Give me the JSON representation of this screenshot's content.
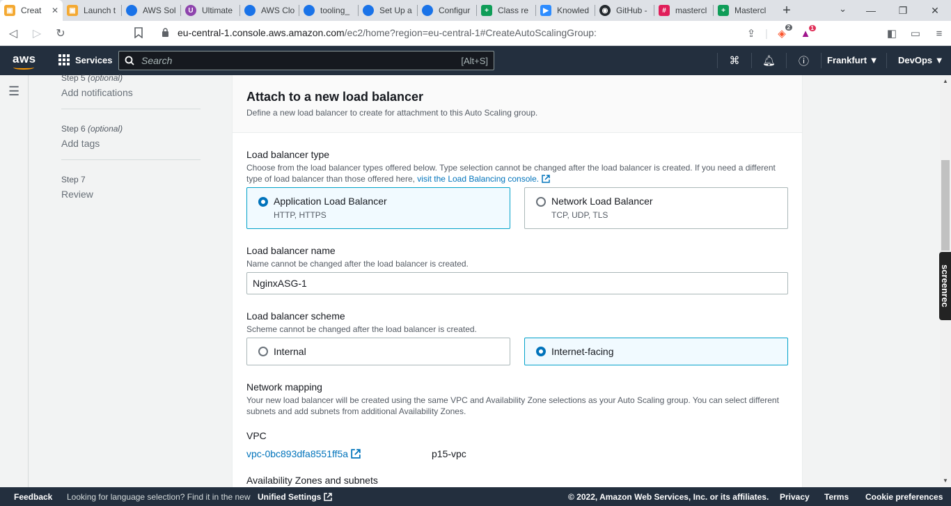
{
  "browser": {
    "tabs": [
      {
        "title": "Creat",
        "icon": "aws-box-icon",
        "color": "#f4a932"
      },
      {
        "title": "Launch t",
        "icon": "aws-box-icon",
        "color": "#f4a932"
      },
      {
        "title": "AWS Sol",
        "icon": "blue-drop-icon",
        "color": "#1a73e8"
      },
      {
        "title": "Ultimate",
        "icon": "purple-circle-icon",
        "color": "#8e44ad"
      },
      {
        "title": "AWS Clo",
        "icon": "blue-drop-icon",
        "color": "#1a73e8"
      },
      {
        "title": "tooling_",
        "icon": "blue-drop-icon",
        "color": "#1a73e8"
      },
      {
        "title": "Set Up a",
        "icon": "blue-drop-icon",
        "color": "#1a73e8"
      },
      {
        "title": "Configur",
        "icon": "blue-drop-icon",
        "color": "#1a73e8"
      },
      {
        "title": "Class re",
        "icon": "green-plus-icon",
        "color": "#0f9d58"
      },
      {
        "title": "Knowled",
        "icon": "zoom-icon",
        "color": "#2d8cff"
      },
      {
        "title": "GitHub -",
        "icon": "github-icon",
        "color": "#24292e"
      },
      {
        "title": "mastercl",
        "icon": "slack-icon",
        "color": "#e01e5a"
      },
      {
        "title": "Mastercl",
        "icon": "green-plus-icon",
        "color": "#0f9d58"
      }
    ],
    "url_host": "eu-central-1.console.aws.amazon.com",
    "url_path": "/ec2/home?region=eu-central-1#CreateAutoScalingGroup:",
    "brave_badge": "2",
    "alert_badge": "1"
  },
  "aws": {
    "logo": "aws",
    "services_label": "Services",
    "search_placeholder": "Search",
    "search_shortcut": "[Alt+S]",
    "region": "Frankfurt ▼",
    "account": "DevOps ▼"
  },
  "steps": [
    {
      "num": "Step 5",
      "optional": "(optional)",
      "label": "Add notifications"
    },
    {
      "num": "Step 6",
      "optional": "(optional)",
      "label": "Add tags"
    },
    {
      "num": "Step 7",
      "optional": "",
      "label": "Review"
    }
  ],
  "main": {
    "title": "Attach to a new load balancer",
    "description": "Define a new load balancer to create for attachment to this Auto Scaling group.",
    "lb_type": {
      "label": "Load balancer type",
      "desc": "Choose from the load balancer types offered below. Type selection cannot be changed after the load balancer is created. If you need a different type of load balancer than those offered here,",
      "link": "visit the Load Balancing console.",
      "options": [
        {
          "title": "Application Load Balancer",
          "sub": "HTTP, HTTPS",
          "selected": true
        },
        {
          "title": "Network Load Balancer",
          "sub": "TCP, UDP, TLS",
          "selected": false
        }
      ]
    },
    "lb_name": {
      "label": "Load balancer name",
      "desc": "Name cannot be changed after the load balancer is created.",
      "value": "NginxASG-1"
    },
    "lb_scheme": {
      "label": "Load balancer scheme",
      "desc": "Scheme cannot be changed after the load balancer is created.",
      "options": [
        {
          "title": "Internal",
          "selected": false
        },
        {
          "title": "Internet-facing",
          "selected": true
        }
      ]
    },
    "network": {
      "label": "Network mapping",
      "desc": "Your new load balancer will be created using the same VPC and Availability Zone selections as your Auto Scaling group. You can select different subnets and add subnets from additional Availability Zones.",
      "vpc_label": "VPC",
      "vpc_id": "vpc-0bc893dfa8551ff5a",
      "vpc_name": "p15-vpc",
      "az_label": "Availability Zones and subnets"
    }
  },
  "footer": {
    "feedback": "Feedback",
    "lang_prompt": "Looking for language selection? Find it in the new",
    "unified_settings": "Unified Settings",
    "copyright": "© 2022, Amazon Web Services, Inc. or its affiliates.",
    "privacy": "Privacy",
    "terms": "Terms",
    "cookies": "Cookie preferences"
  },
  "overlay": {
    "screenrec": "screenrec"
  }
}
